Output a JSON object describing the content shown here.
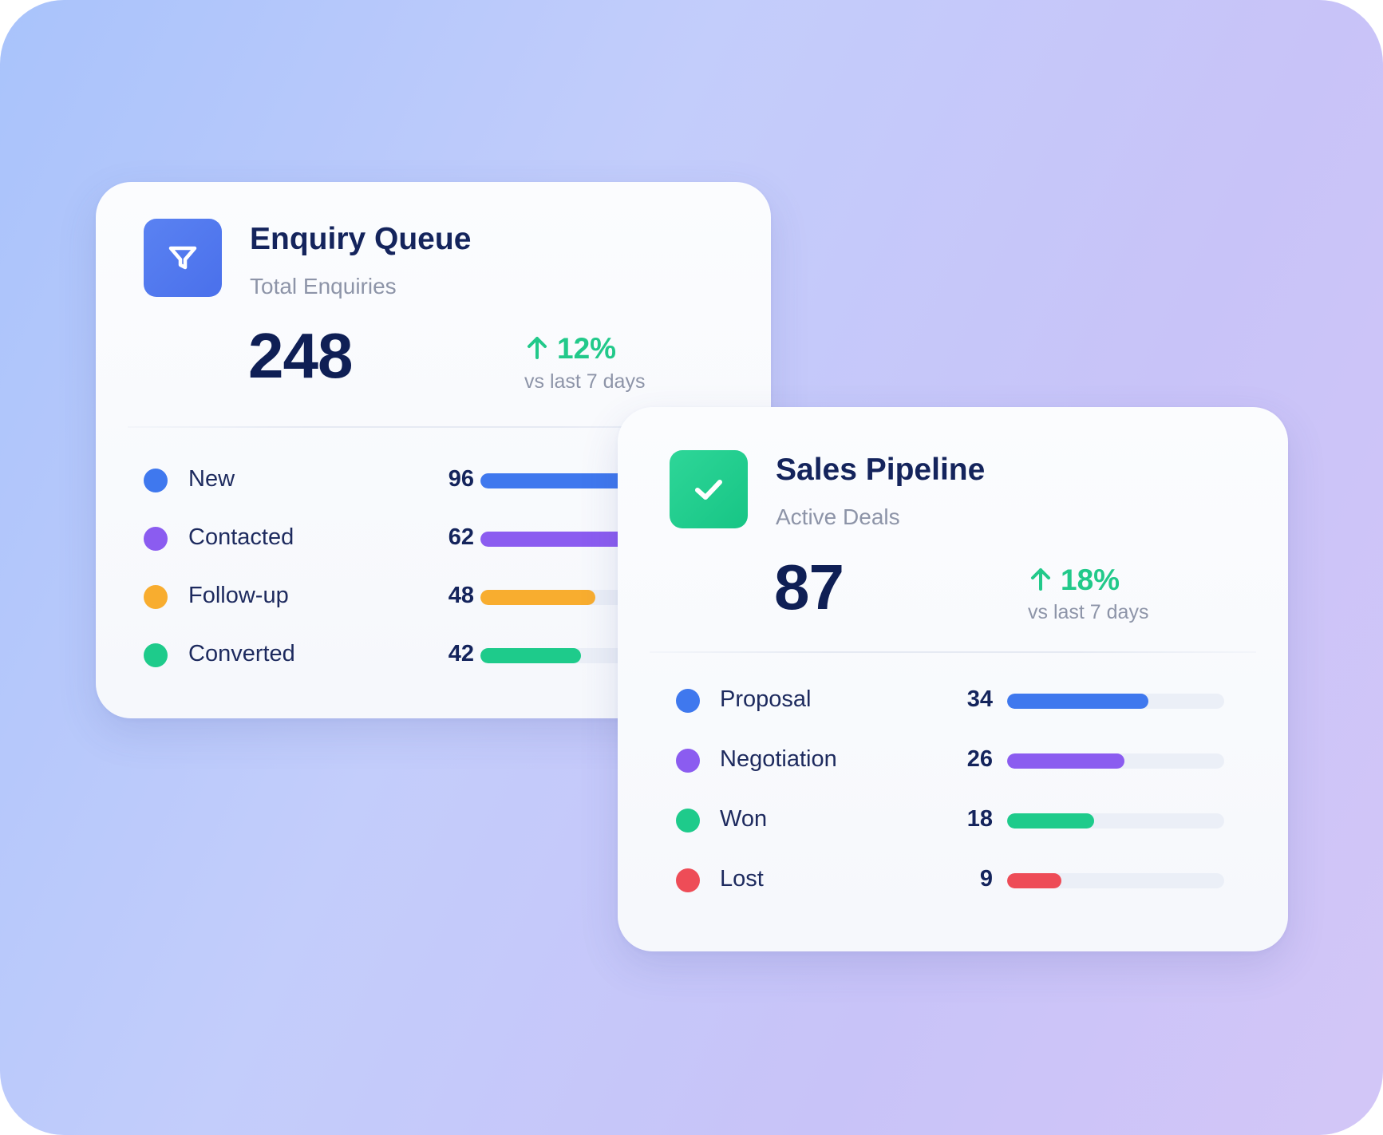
{
  "colors": {
    "blue": "#3f78ee",
    "purple": "#8b5cf0",
    "orange": "#f8ad2f",
    "green": "#1ecb8b",
    "red": "#ee4c57",
    "trend_green": "#22c98a",
    "title_navy": "#14245c"
  },
  "enquiry_queue": {
    "icon": "filter-funnel-icon",
    "title": "Enquiry Queue",
    "subtitle": "Total Enquiries",
    "total": "248",
    "trend": {
      "icon": "arrow-up-icon",
      "value": "12%",
      "caption": "vs last 7 days"
    },
    "rows": [
      {
        "label": "New",
        "count": "96",
        "color": "blue",
        "fraction": 0.96
      },
      {
        "label": "Contacted",
        "count": "62",
        "color": "purple",
        "fraction": 0.62
      },
      {
        "label": "Follow-up",
        "count": "48",
        "color": "orange",
        "fraction": 0.48
      },
      {
        "label": "Converted",
        "count": "42",
        "color": "green",
        "fraction": 0.42
      }
    ]
  },
  "sales_pipeline": {
    "icon": "checkmark-icon",
    "title": "Sales Pipeline",
    "subtitle": "Active Deals",
    "total": "87",
    "trend": {
      "icon": "arrow-up-icon",
      "value": "18%",
      "caption": "vs last 7 days"
    },
    "rows": [
      {
        "label": "Proposal",
        "count": "34",
        "color": "blue",
        "fraction": 0.65
      },
      {
        "label": "Negotiation",
        "count": "26",
        "color": "purple",
        "fraction": 0.54
      },
      {
        "label": "Won",
        "count": "18",
        "color": "green",
        "fraction": 0.4
      },
      {
        "label": "Lost",
        "count": "9",
        "color": "red",
        "fraction": 0.25
      }
    ]
  }
}
